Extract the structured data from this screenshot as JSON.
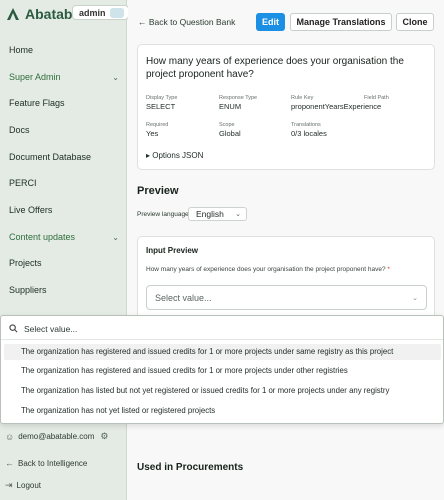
{
  "brand": {
    "name": "Abatable",
    "role_pill": "admin"
  },
  "sidebar": {
    "items": [
      {
        "label": "Home",
        "expandable": false
      },
      {
        "label": "Super Admin",
        "expandable": true
      },
      {
        "label": "Feature Flags",
        "expandable": false
      },
      {
        "label": "Docs",
        "expandable": false
      },
      {
        "label": "Document Database",
        "expandable": false
      },
      {
        "label": "PERCI",
        "expandable": false
      },
      {
        "label": "Live Offers",
        "expandable": false
      },
      {
        "label": "Content updates",
        "expandable": true
      },
      {
        "label": "Projects",
        "expandable": false
      },
      {
        "label": "Suppliers",
        "expandable": false
      }
    ],
    "user_email": "demo@abatable.com",
    "back_label": "Back to Intelligence",
    "logout_label": "Logout"
  },
  "toolbar": {
    "back_label": "Back to Question Bank",
    "edit_label": "Edit",
    "translations_label": "Manage Translations",
    "clone_label": "Clone"
  },
  "question": {
    "title": "How many years of experience does your organisation the project proponent have?",
    "meta": {
      "display_type_label": "Display Type",
      "display_type": "SELECT",
      "response_type_label": "Response Type",
      "response_type": "ENUM",
      "rule_key_label": "Rule Key",
      "rule_key": "proponentYearsExperience",
      "field_path_label": "Field Path",
      "field_path": "",
      "required_label": "Required",
      "required": "Yes",
      "scope_label": "Scope",
      "scope": "Global",
      "translations_label": "Translations",
      "translations": "0/3 locales"
    },
    "options_json_label": "Options JSON"
  },
  "preview": {
    "heading": "Preview",
    "language_label": "Preview language:",
    "language_value": "English",
    "input_title": "Input Preview",
    "question_text": "How many years of experience does your organisation the project proponent have?",
    "required_marker": "*",
    "select_placeholder": "Select value..."
  },
  "dropdown": {
    "search_placeholder": "Select value...",
    "options": [
      "The organization has registered and issued credits for 1 or more projects under same registry as this project",
      "The organization has registered and issued credits for 1 or more projects under other registries",
      "The organization has listed but not yet registered or issued credits for 1 or more projects under any registry",
      "The organization has not yet listed or registered projects"
    ],
    "highlighted_index": 0
  },
  "procurements": {
    "heading": "Used in Procurements"
  },
  "colors": {
    "primary": "#1a8fe3",
    "sidebar_bg": "#e4ebe4",
    "brand_green": "#2b5a3f",
    "required": "#d0331f"
  }
}
